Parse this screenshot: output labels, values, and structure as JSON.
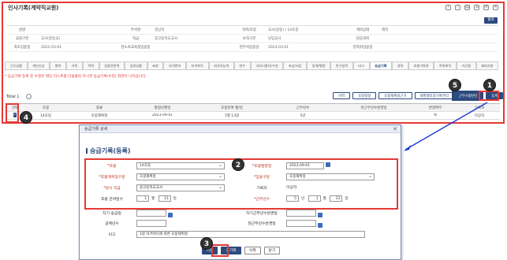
{
  "main": {
    "title": "인사기록(계약직교원)",
    "print_label": "출력",
    "info_rows": [
      [
        {
          "l": "성명",
          "v": ""
        },
        {
          "l": "부서명",
          "v": "경상북"
        },
        {
          "l": "직위/호봉",
          "v": "교사(중등) / 14호봉"
        },
        {
          "l": "계약상태",
          "v": "해직"
        }
      ],
      [
        {
          "l": "교원구분",
          "v": "교사(중등교)"
        },
        {
          "l": "직급",
          "v": "중고등학교교사"
        },
        {
          "l": "보직구분",
          "v": "담임교사"
        },
        {
          "l": "담당과목",
          "v": ""
        }
      ],
      [
        {
          "l": "최초임용일",
          "v": "2022-03-01"
        },
        {
          "l": "현소속교육청임용일",
          "v": ""
        },
        {
          "l": "현부서임용일",
          "v": "2023-03-01"
        },
        {
          "l": "현직위임용일",
          "v": ""
        }
      ]
    ],
    "tabs": [
      "근무상황",
      "개인신상",
      "병역",
      "가족",
      "학력",
      "임용연관력",
      "임관상황",
      "표창",
      "자격면허",
      "자격취득",
      "외국어능력",
      "연수",
      "국외시찰/유수연",
      "포상/서훈",
      "징계/행정",
      "연구실적",
      "비고",
      "승급기록",
      "경력",
      "호봉기록관",
      "학위취득",
      "가산점",
      "제외사항"
    ],
    "active_tab": "승급기록",
    "notice": "* 승급기록 등록 후 수정은 해당 리스트를 더블클릭 하시면 승급기록(수정) 화면이 나타납니다.",
    "total_label": "Total 1",
    "buttons": [
      "이력",
      "호봉정정",
      "호봉재획정근거",
      "재발행호봉기록관리",
      "근무사항변경",
      "등록"
    ],
    "grid_headers": [
      "선택",
      "호봉",
      "종류",
      "발령년월일",
      "호봉잔여 월/일",
      "근무년수",
      "현근무년수변경일",
      "변경여부",
      "기록자"
    ],
    "grid_rows": [
      [
        "",
        "14호봉",
        "호봉재획정",
        "2023-09-01",
        "1월 13일",
        "5년",
        "",
        "N",
        "이상하"
      ]
    ]
  },
  "dialog": {
    "titlebar": "승급기록 상세",
    "close_glyph": "✕",
    "heading": "승급기록(등록)",
    "fields": {
      "hobong_label": "*호봉",
      "hobong_value": "14호봉",
      "start_date_label": "*호봉발령일",
      "start_date_value": "2023-09-01",
      "kind_label": "*호봉재획정구분",
      "kind_value": "호봉재획정",
      "appoint_label": "*임용구분",
      "appoint_value": "호봉재획정",
      "rank_label": "*당시 직급",
      "rank_value": "중고등학교교사",
      "recorder_label": "기록자",
      "recorder_value": "이상하",
      "remain_label": "호봉 잔여일수",
      "remain_month": "1",
      "remain_day": "13",
      "service_label": "*근무년수",
      "service_year": "5",
      "service_month": "1",
      "service_day": "13",
      "next_label": "차기 승급일",
      "next_change_label": "차기근무년수변경일",
      "deduct_label": "공제년수",
      "cur_change_label": "현근무년수변경일",
      "note_label": "비고",
      "note_value": "1항 자격취득에 따른 호봉재획정",
      "unit_month": "월",
      "unit_day": "일",
      "unit_year": "년"
    },
    "buttons": {
      "save": "저장",
      "reset": "초기화",
      "delete": "삭제",
      "close": "닫기"
    }
  },
  "markers": [
    "1",
    "2",
    "3",
    "4",
    "5"
  ]
}
